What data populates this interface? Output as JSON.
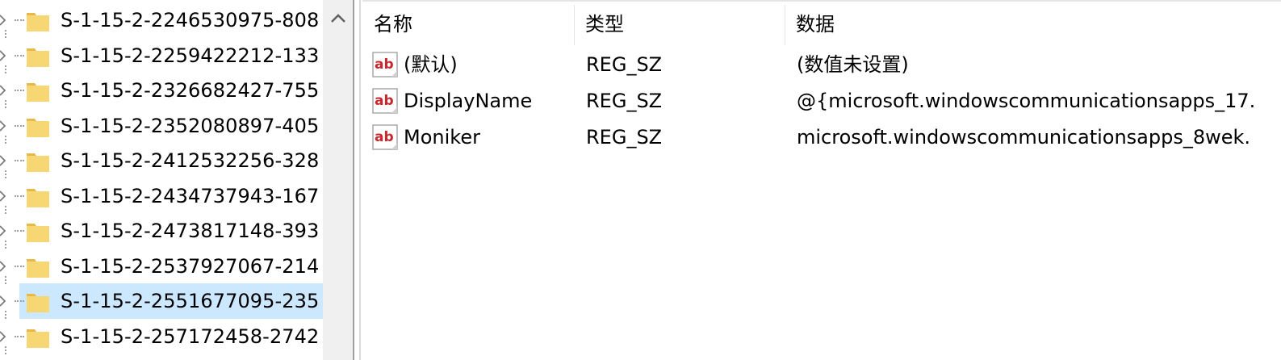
{
  "tree": {
    "items": [
      {
        "label": "S-1-15-2-2246530975-808"
      },
      {
        "label": "S-1-15-2-2259422212-133"
      },
      {
        "label": "S-1-15-2-2326682427-755"
      },
      {
        "label": "S-1-15-2-2352080897-405"
      },
      {
        "label": "S-1-15-2-2412532256-328"
      },
      {
        "label": "S-1-15-2-2434737943-167"
      },
      {
        "label": "S-1-15-2-2473817148-393"
      },
      {
        "label": "S-1-15-2-2537927067-214"
      },
      {
        "label": "S-1-15-2-2551677095-235"
      },
      {
        "label": "S-1-15-2-257172458-2742"
      }
    ],
    "selected_index": 8,
    "folder_color": "#f7d774",
    "selection_color": "#cce8ff"
  },
  "scrollbar": {
    "up_icon": "chevron-up-icon"
  },
  "list": {
    "columns": {
      "name": "名称",
      "type": "类型",
      "data": "数据"
    },
    "rows": [
      {
        "name": "(默认)",
        "type": "REG_SZ",
        "data": "(数值未设置)",
        "icon": "string-value-icon"
      },
      {
        "name": "DisplayName",
        "type": "REG_SZ",
        "data": "@{microsoft.windowscommunicationsapps_17.",
        "icon": "string-value-icon"
      },
      {
        "name": "Moniker",
        "type": "REG_SZ",
        "data": "microsoft.windowscommunicationsapps_8wek.",
        "icon": "string-value-icon"
      }
    ]
  }
}
